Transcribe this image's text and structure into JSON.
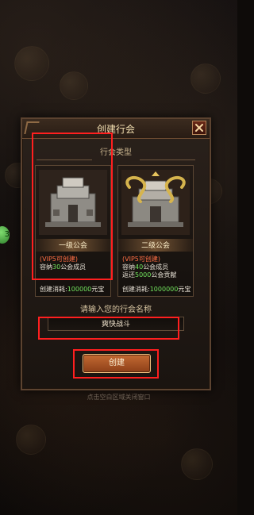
{
  "dialog": {
    "title": "创建行会",
    "close_label": "X",
    "subtitle": "行会类型",
    "cards": [
      {
        "name": "一级公会",
        "vip": "(VIP5可创建)",
        "lines": [
          {
            "prefix": "容纳",
            "num": "30",
            "suffix": "公会成员"
          }
        ],
        "cost_prefix": "创建消耗:",
        "cost_value": "100000",
        "cost_unit": "元宝"
      },
      {
        "name": "二级公会",
        "vip": "(VIP5可创建)",
        "lines": [
          {
            "prefix": "容纳",
            "num": "40",
            "suffix": "公会成员"
          },
          {
            "prefix": "返还",
            "num": "5000",
            "suffix": "公会贡献"
          }
        ],
        "cost_prefix": "创建消耗:",
        "cost_value": "1000000",
        "cost_unit": "元宝"
      }
    ],
    "name_label": "请输入您的行会名称",
    "name_value": "爽快战斗",
    "create_label": "创建"
  },
  "hint": "点击空白区域关闭窗口",
  "left_badge": "3",
  "colors": {
    "highlight": "#ff1f1f",
    "accent_green": "#72e45e",
    "accent_orange": "#ff6f45"
  }
}
